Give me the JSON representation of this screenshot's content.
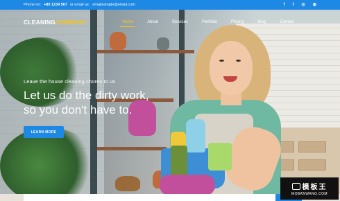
{
  "topbar": {
    "phone_label": "Phone no:",
    "phone": "+80 1234 567",
    "email_label": "or email us:",
    "email": "emailsample@email.com",
    "social_icons": [
      "facebook-icon",
      "twitter-icon",
      "instagram-icon",
      "dribbble-icon"
    ],
    "social_glyphs": [
      "f",
      "ð",
      "◎",
      "◍"
    ]
  },
  "brand": {
    "part1": "CLEANING",
    "part2": "COMPANY",
    "accent_color": "#f5c518",
    "primary_color": "#1e88e5"
  },
  "nav": {
    "items": [
      {
        "label": "Home",
        "active": true
      },
      {
        "label": "About"
      },
      {
        "label": "Services"
      },
      {
        "label": "Portfolio"
      },
      {
        "label": "Pricing"
      },
      {
        "label": "Blog"
      },
      {
        "label": "Contact"
      }
    ]
  },
  "hero": {
    "eyebrow": "Leave the house cleaning chores to us",
    "headline_line1": "Let us do the dirty work,",
    "headline_line2": "so you don't have to.",
    "cta_label": "LEARN MORE"
  },
  "watermark": {
    "text": "模板王",
    "url": "MOBANWANG.COM"
  }
}
